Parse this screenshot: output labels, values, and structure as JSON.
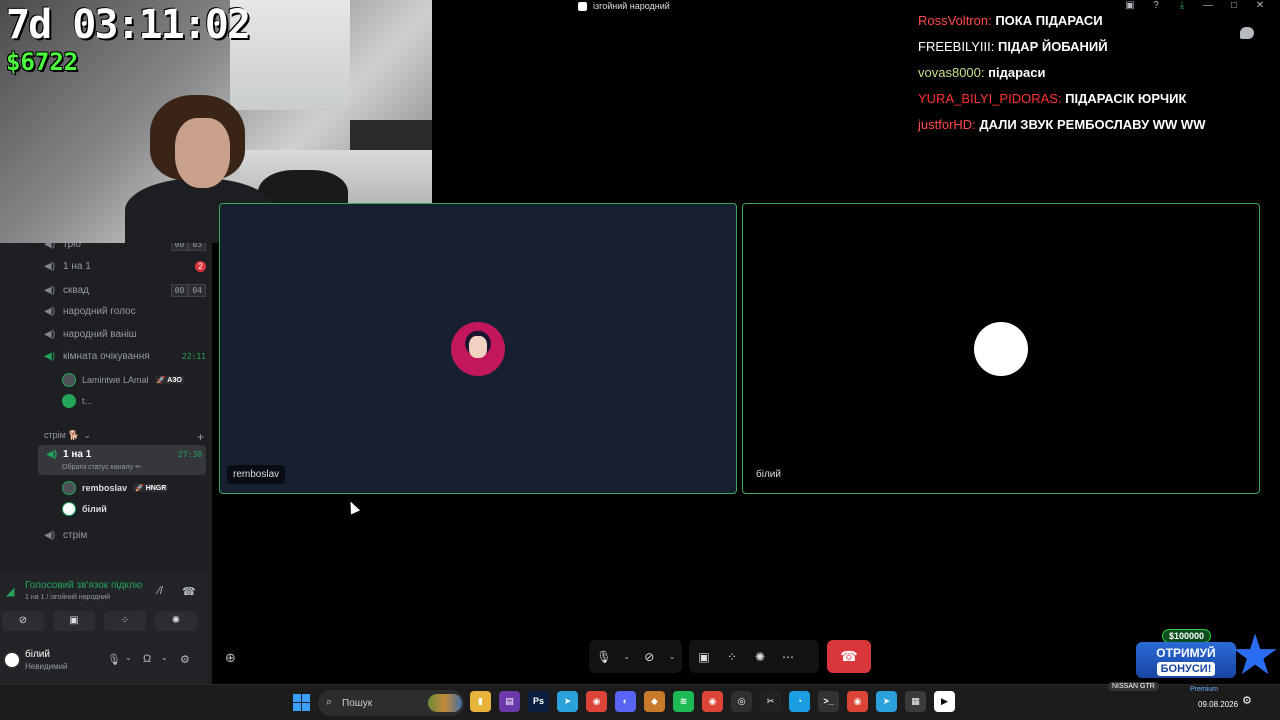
{
  "window": {
    "title": "ізгойний народний"
  },
  "stream_overlay": {
    "timer": "7d 03:11:02",
    "money": "$6722"
  },
  "chat": [
    {
      "user": "RossVoltron:",
      "color": "#ff4b4b",
      "message": "ПОКА ПІДАРАСИ"
    },
    {
      "user": "FREEBILYIII:",
      "color": "#ffffff",
      "message": "ПІДАР ЙОБАНИЙ"
    },
    {
      "user": "vovas8000:",
      "color": "#c7e08a",
      "message": "підараси"
    },
    {
      "user": "YURA_BILYI_PIDORAS:",
      "color": "#ff3333",
      "message": "ПІДАРАСІК ЮРЧИК"
    },
    {
      "user": "justforHD:",
      "color": "#ff4b4b",
      "message": "ДАЛИ ЗВУК РЕМБОСЛАВУ WW WW"
    }
  ],
  "sidebar": {
    "channels": [
      {
        "name": "тріо",
        "counts": [
          "00",
          "03"
        ]
      },
      {
        "name": "1 на 1",
        "badge": "2"
      },
      {
        "name": "сквад",
        "counts": [
          "00",
          "04"
        ]
      },
      {
        "name": "народний голос"
      },
      {
        "name": "народний ваніш"
      },
      {
        "name": "кімната очікування",
        "time": "22:11"
      }
    ],
    "waiting_users": [
      {
        "name": "Lamintwe LAmal",
        "tag": "🚀 АЗО"
      },
      {
        "name": "t..."
      }
    ],
    "category": "стрім 🐕",
    "selected_channel": {
      "name": "1 на 1",
      "status_hint": "Обрати статус каналу ✏",
      "time": "27:38"
    },
    "members": [
      {
        "name": "remboslav",
        "tag": "🚀 HNGR"
      },
      {
        "name": "білий"
      }
    ],
    "last_channel": "стрім"
  },
  "voice_panel": {
    "status": "Голосовий зв'язок підклю",
    "sub": "1 на 1 / ізгойний народний"
  },
  "user_panel": {
    "name": "білий",
    "status": "Невидимий"
  },
  "tiles": [
    {
      "label": "remboslav"
    },
    {
      "label": "білий"
    }
  ],
  "promo": {
    "amount": "$100000",
    "line1": "ОТРИМУЙ",
    "line2": "БОНУСИ!"
  },
  "taskbar": {
    "search_placeholder": "Пошук",
    "nissan": "NISSAN GTR",
    "premium": "Premium",
    "date": "09.08.2026",
    "apps": [
      {
        "icon": "file-explorer-icon",
        "color": "#e8b33a",
        "glyph": "▮"
      },
      {
        "icon": "media-app-icon",
        "color": "#6a3aa8",
        "glyph": "▤"
      },
      {
        "icon": "photoshop-icon",
        "color": "#0b1e3f",
        "glyph": "Ps"
      },
      {
        "icon": "telegram-icon",
        "color": "#2aa1da",
        "glyph": "➤"
      },
      {
        "icon": "chrome-icon",
        "color": "#db4437",
        "glyph": "◉"
      },
      {
        "icon": "discord-icon",
        "color": "#5865f2",
        "glyph": "◐"
      },
      {
        "icon": "guard-app-icon",
        "color": "#c77a2a",
        "glyph": "◆"
      },
      {
        "icon": "spotify-icon",
        "color": "#1db954",
        "glyph": "≋"
      },
      {
        "icon": "chrome-icon",
        "color": "#db4437",
        "glyph": "◉"
      },
      {
        "icon": "obs-icon",
        "color": "#302e31",
        "glyph": "◎"
      },
      {
        "icon": "capcut-icon",
        "color": "#222",
        "glyph": "✂"
      },
      {
        "icon": "edge-icon",
        "color": "#1b9de2",
        "glyph": "◔"
      },
      {
        "icon": "terminal-icon",
        "color": "#333",
        "glyph": ">_"
      },
      {
        "icon": "chrome-icon",
        "color": "#db4437",
        "glyph": "◉"
      },
      {
        "icon": "telegram-icon",
        "color": "#2aa1da",
        "glyph": "➤"
      },
      {
        "icon": "calculator-icon",
        "color": "#3b3b3b",
        "glyph": "▦"
      },
      {
        "icon": "media-player-icon",
        "color": "#ffffff",
        "glyph": "▶"
      }
    ]
  }
}
